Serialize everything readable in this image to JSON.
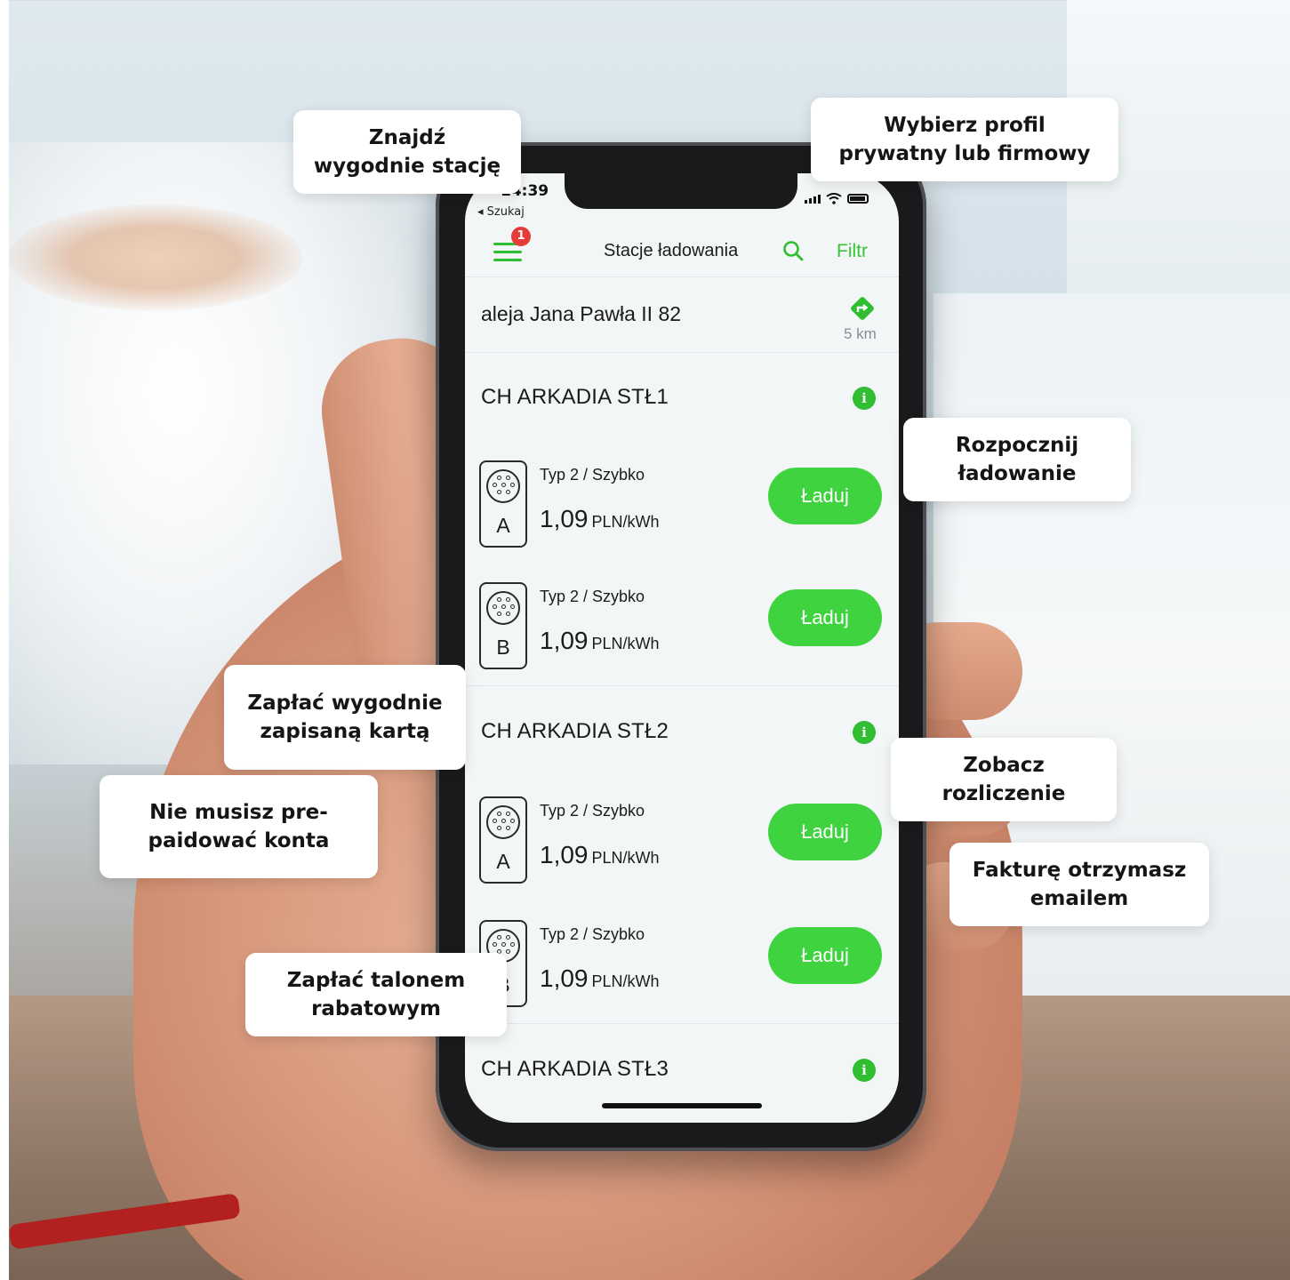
{
  "status_bar": {
    "time": "14:39",
    "back_label": "◂ Szukaj"
  },
  "nav": {
    "title": "Stacje ładowania",
    "filter_label": "Filtr",
    "badge_count": "1"
  },
  "address": {
    "text": "aleja Jana Pawła II 82",
    "distance": "5 km"
  },
  "stations": [
    {
      "name": "CH ARKADIA STŁ1",
      "connectors": [
        {
          "letter": "A",
          "type": "Typ 2 / Szybko",
          "price": "1,09",
          "unit": "PLN/kWh",
          "button": "Ładuj"
        },
        {
          "letter": "B",
          "type": "Typ 2 / Szybko",
          "price": "1,09",
          "unit": "PLN/kWh",
          "button": "Ładuj"
        }
      ]
    },
    {
      "name": "CH ARKADIA STŁ2",
      "connectors": [
        {
          "letter": "A",
          "type": "Typ 2 / Szybko",
          "price": "1,09",
          "unit": "PLN/kWh",
          "button": "Ładuj"
        },
        {
          "letter": "B",
          "type": "Typ 2 / Szybko",
          "price": "1,09",
          "unit": "PLN/kWh",
          "button": "Ładuj"
        }
      ]
    },
    {
      "name": "CH ARKADIA STŁ3",
      "connectors": []
    }
  ],
  "callouts": {
    "find_station": "Znajdź\nwygodnie stację",
    "profile": "Wybierz profil\nprywatny lub firmowy",
    "start_charging": "Rozpocznij\nładowanie",
    "pay_card": "Zapłać wygodnie\nzapisaną kartą",
    "no_prepaid": "Nie musisz pre-\npaidować konta",
    "see_billing": "Zobacz\nrozliczenie",
    "invoice_email": "Fakturę otrzymasz\nemailem",
    "pay_coupon": "Zapłać talonem\nrabatowym"
  },
  "colors": {
    "accent_green": "#3fd43f",
    "badge_red": "#e53b3b",
    "callout_bg": "#ffffff"
  }
}
